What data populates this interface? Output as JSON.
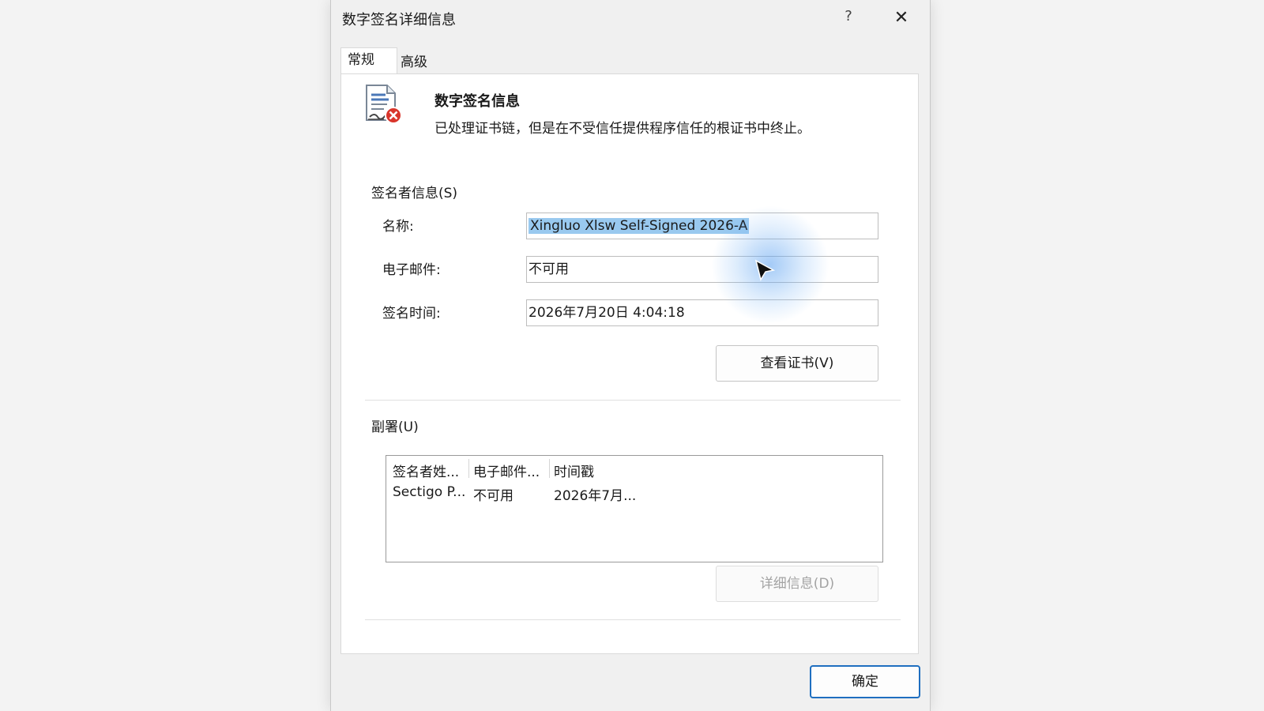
{
  "window": {
    "title": "数字签名详细信息",
    "help_label": "?",
    "close_label": "✕"
  },
  "tabs": [
    {
      "label": "常规",
      "active": true
    },
    {
      "label": "高级",
      "active": false
    }
  ],
  "signature_info": {
    "title": "数字签名信息",
    "status": "已处理证书链，但是在不受信任提供程序信任的根证书中终止。",
    "icon": "certificate-error-icon"
  },
  "signer": {
    "section_label": "签名者信息(S)",
    "name_label": "名称:",
    "name_value": "Xingluo Xlsw Self-Signed 2026-A",
    "email_label": "电子邮件:",
    "email_value": "不可用",
    "time_label": "签名时间:",
    "time_value": "2026年7月20日 4:04:18",
    "view_cert_button": "查看证书(V)"
  },
  "countersignatures": {
    "section_label": "副署(U)",
    "columns": [
      "签名者姓...",
      "电子邮件...",
      "时间戳"
    ],
    "rows": [
      [
        "Sectigo P...",
        "不可用",
        "2026年7月..."
      ]
    ],
    "details_button": "详细信息(D)"
  },
  "footer": {
    "ok_button": "确定"
  },
  "colors": {
    "selection": "#99c9ef",
    "ok_border": "#1f6fc0",
    "error_red": "#d9352b"
  }
}
